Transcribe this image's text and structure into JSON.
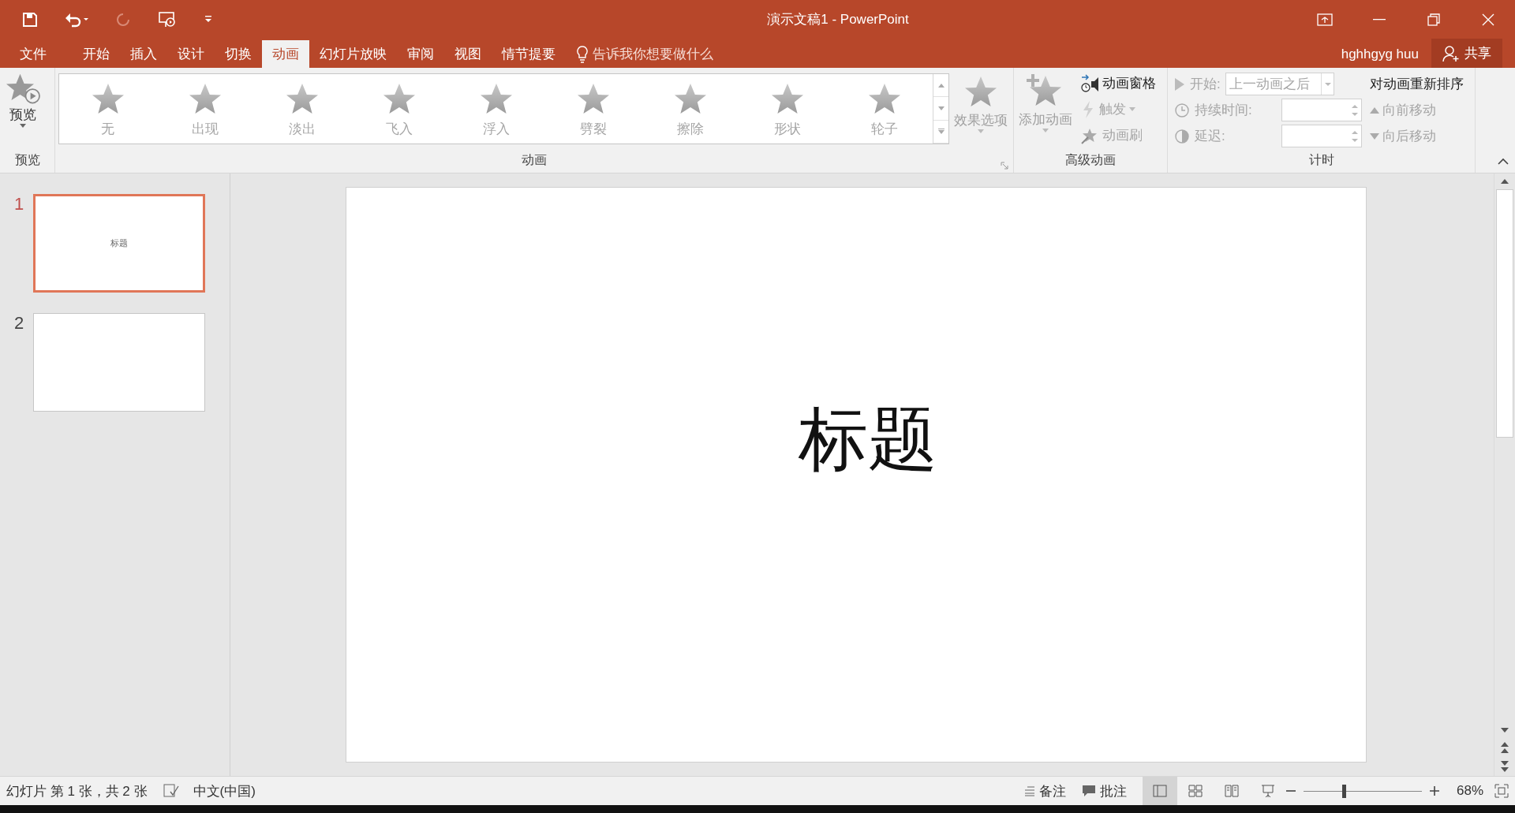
{
  "window": {
    "title": "演示文稿1 - PowerPoint"
  },
  "tabs": [
    {
      "label": "文件",
      "selected": false
    },
    {
      "label": "开始",
      "selected": false
    },
    {
      "label": "插入",
      "selected": false
    },
    {
      "label": "设计",
      "selected": false
    },
    {
      "label": "切换",
      "selected": false
    },
    {
      "label": "动画",
      "selected": true
    },
    {
      "label": "幻灯片放映",
      "selected": false
    },
    {
      "label": "审阅",
      "selected": false
    },
    {
      "label": "视图",
      "selected": false
    },
    {
      "label": "情节提要",
      "selected": false
    }
  ],
  "tell_me": {
    "placeholder": "告诉我你想要做什么"
  },
  "user": "hghhgyg huu",
  "share_button": "共享",
  "ribbon": {
    "preview": {
      "button": "预览",
      "label": "预览"
    },
    "animation": {
      "label": "动画",
      "disabled": true,
      "effects": [
        {
          "label": "无"
        },
        {
          "label": "出现"
        },
        {
          "label": "淡出"
        },
        {
          "label": "飞入"
        },
        {
          "label": "浮入"
        },
        {
          "label": "劈裂"
        },
        {
          "label": "擦除"
        },
        {
          "label": "形状"
        },
        {
          "label": "轮子"
        }
      ],
      "effect_options": "效果选项"
    },
    "advanced": {
      "label": "高级动画",
      "add_animation": {
        "label": "添加动画",
        "disabled": true
      },
      "items": [
        {
          "label": "动画窗格",
          "disabled": false
        },
        {
          "label": "触发",
          "disabled": true
        },
        {
          "label": "动画刷",
          "disabled": true
        }
      ]
    },
    "timing": {
      "label": "计时",
      "start_label": "开始:",
      "start_value": "上一动画之后",
      "duration_label": "持续时间:",
      "delay_label": "延迟:",
      "reorder_title": "对动画重新排序",
      "move_earlier": "向前移动",
      "move_later": "向后移动",
      "disabled": true
    }
  },
  "slides": [
    {
      "number": "1",
      "title": "标题",
      "selected": true
    },
    {
      "number": "2",
      "selected": false
    }
  ],
  "current_slide": {
    "title": "标题"
  },
  "status_bar": {
    "slide_info": "幻灯片 第 1 张，共 2 张",
    "language": "中文(中国)",
    "notes": "备注",
    "comments": "批注",
    "zoom": {
      "level": 0.34
    },
    "zoom_value": "68%"
  }
}
